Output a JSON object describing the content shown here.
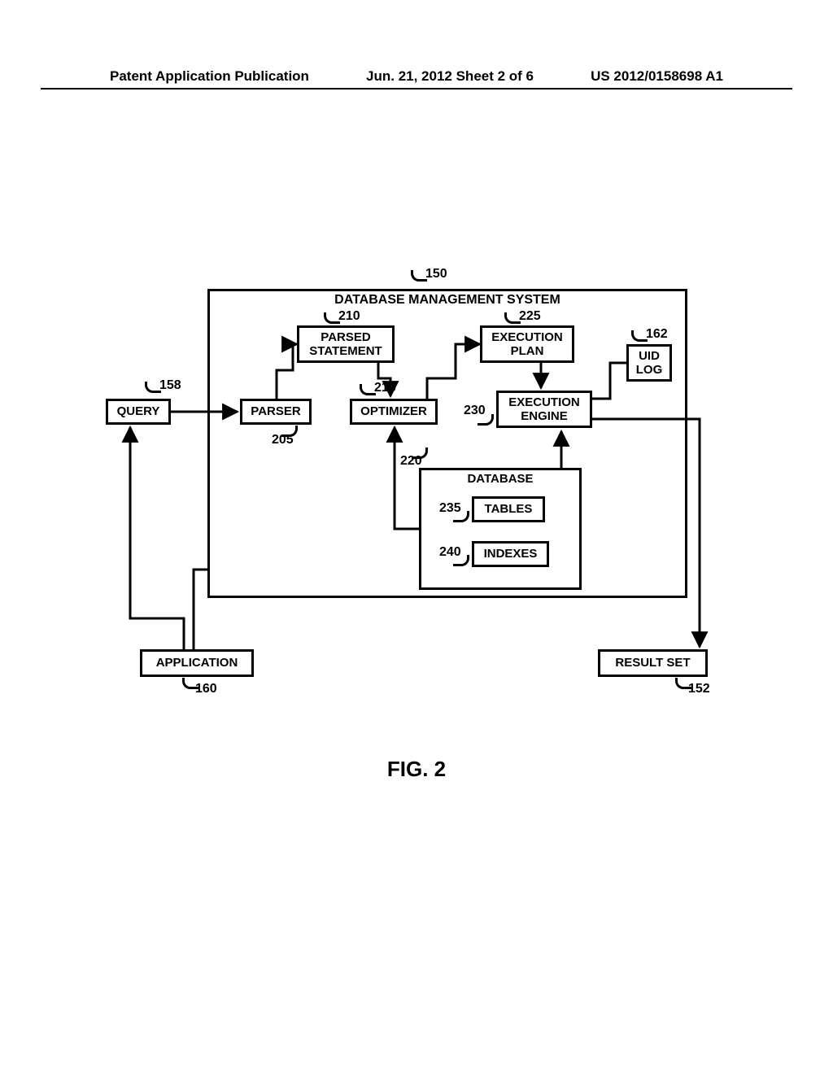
{
  "header": {
    "left": "Patent Application Publication",
    "mid": "Jun. 21, 2012  Sheet 2 of 6",
    "right": "US 2012/0158698 A1"
  },
  "dbms_title": "DATABASE MANAGEMENT SYSTEM",
  "db_title": "DATABASE",
  "boxes": {
    "query": "QUERY",
    "parser": "PARSER",
    "parsed_statement": "PARSED\nSTATEMENT",
    "optimizer": "OPTIMIZER",
    "execution_plan": "EXECUTION\nPLAN",
    "execution_engine": "EXECUTION\nENGINE",
    "uid_log": "UID\nLOG",
    "tables": "TABLES",
    "indexes": "INDEXES",
    "application": "APPLICATION",
    "result_set": "RESULT SET"
  },
  "refs": {
    "r150": "150",
    "r158": "158",
    "r205": "205",
    "r210": "210",
    "r215": "215",
    "r220": "220",
    "r225": "225",
    "r230": "230",
    "r162": "162",
    "r235": "235",
    "r240": "240",
    "r160": "160",
    "r152": "152"
  },
  "figure_caption": "FIG. 2"
}
